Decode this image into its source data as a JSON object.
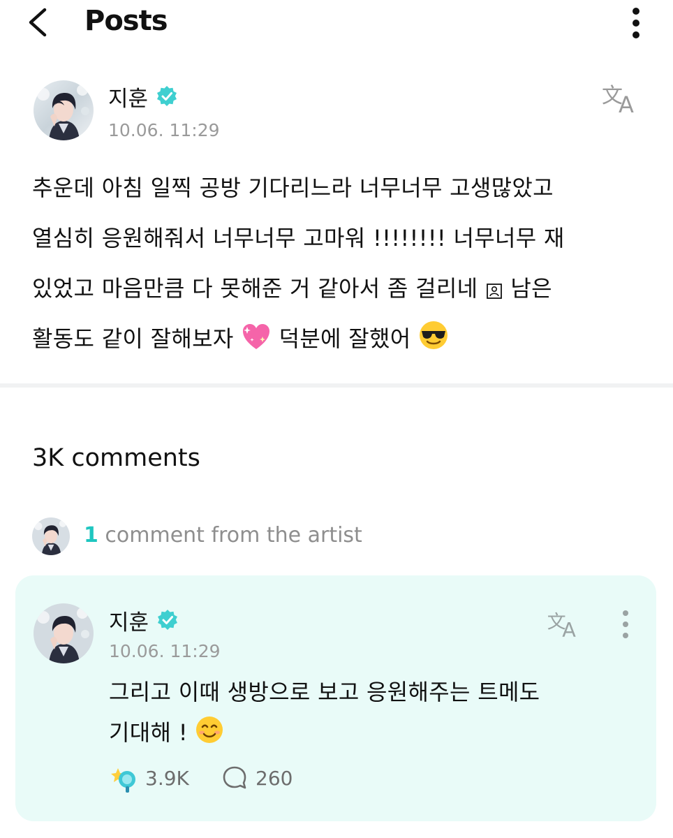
{
  "header": {
    "title": "Posts"
  },
  "post": {
    "author": "지훈",
    "timestamp": "10.06. 11:29",
    "body_lines": [
      "추운데 아침 일찍 공방 기다리느라 너무너무 고생많았고",
      "열심히 응원해줘서 너무너무 고마워 !!!!!!!! 너무너무 재",
      "있었고 마음만큼 다 못해준 거 같아서 좀 걸리네",
      "남은",
      "활동도 같이 잘해보자",
      "덕분에 잘했어"
    ]
  },
  "comments": {
    "count_label": "3K comments",
    "artist_count": "1",
    "artist_label": " comment from the artist"
  },
  "artist_comment": {
    "author": "지훈",
    "timestamp": "10.06. 11:29",
    "body_lines": [
      "그리고 이때 생방으로 보고 응원해주는 트메도",
      "기대해 !"
    ],
    "likes": "3.9K",
    "replies": "260"
  },
  "colors": {
    "accent": "#1fc6c0",
    "card_bg": "#e9fbf8",
    "verified": "#3fcfd0",
    "muted_text": "#9a9a9a"
  },
  "icons": {
    "back": "chevron-left-icon",
    "more": "kebab-menu-icon",
    "verified": "verified-badge-icon",
    "translate": "translate-icon",
    "like": "fan-reaction-icon",
    "comment": "comment-bubble-icon"
  }
}
